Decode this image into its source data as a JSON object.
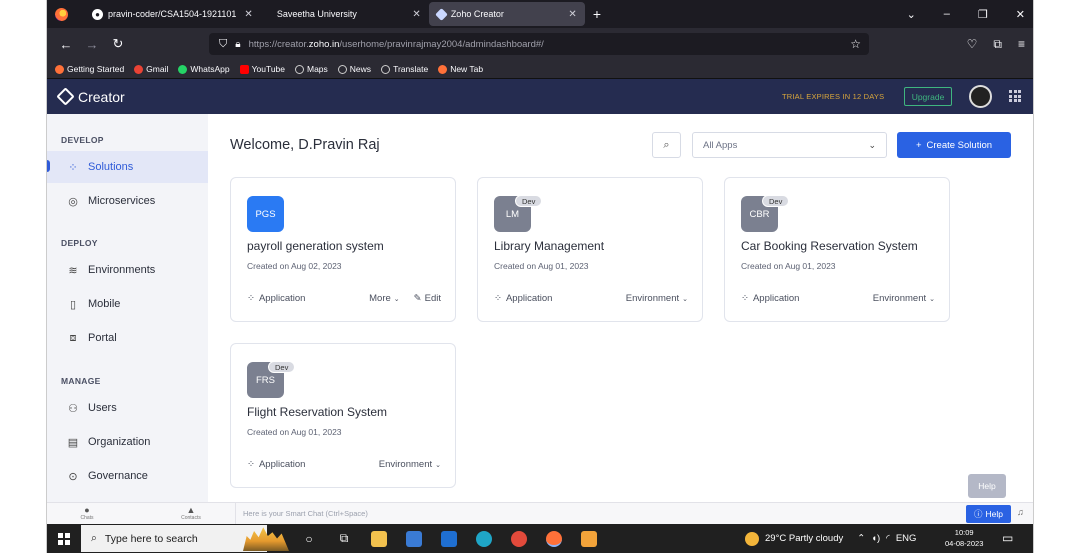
{
  "browser": {
    "tabs": [
      {
        "label": "pravin-coder/CSA1504-1921101",
        "icon": "github-icon"
      },
      {
        "label": "Saveetha University",
        "icon": "page-icon"
      },
      {
        "label": "Zoho Creator",
        "icon": "zoho-icon",
        "active": true
      }
    ],
    "url_prefix": "https://creator.",
    "url_domain": "zoho.in",
    "url_path": "/userhome/pravinrajmay2004/admindashboard#/",
    "bookmarks": [
      {
        "label": "Getting Started",
        "color": "#ff7139"
      },
      {
        "label": "Gmail",
        "color": "#ea4335"
      },
      {
        "label": "WhatsApp",
        "color": "#25d366"
      },
      {
        "label": "YouTube",
        "color": "#ff0000"
      },
      {
        "label": "Maps",
        "color": "#cccccc"
      },
      {
        "label": "News",
        "color": "#cccccc"
      },
      {
        "label": "Translate",
        "color": "#cccccc"
      },
      {
        "label": "New Tab",
        "color": "#ff7139"
      }
    ]
  },
  "app": {
    "name": "Creator",
    "trial_text": "TRIAL EXPIRES IN 12 DAYS",
    "upgrade_label": "Upgrade"
  },
  "sidebar": {
    "sections": [
      {
        "title": "DEVELOP",
        "items": [
          {
            "label": "Solutions",
            "icon": "grid-icon",
            "active": true
          },
          {
            "label": "Microservices",
            "icon": "microservices-icon"
          }
        ]
      },
      {
        "title": "DEPLOY",
        "items": [
          {
            "label": "Environments",
            "icon": "layers-icon"
          },
          {
            "label": "Mobile",
            "icon": "mobile-icon"
          },
          {
            "label": "Portal",
            "icon": "portal-icon"
          }
        ]
      },
      {
        "title": "MANAGE",
        "items": [
          {
            "label": "Users",
            "icon": "users-icon"
          },
          {
            "label": "Organization",
            "icon": "building-icon"
          },
          {
            "label": "Governance",
            "icon": "shield-check-icon"
          }
        ]
      }
    ]
  },
  "main": {
    "welcome": "Welcome, D.Pravin Raj",
    "apps_filter": "All Apps",
    "create_label": "Create Solution",
    "cards": [
      {
        "abbr": "PGS",
        "title": "payroll generation system",
        "created": "Created on Aug 02, 2023",
        "type": "Application",
        "action1": "More",
        "action2": "Edit",
        "dev": false
      },
      {
        "abbr": "LM",
        "title": "Library Management",
        "created": "Created on Aug 01, 2023",
        "type": "Application",
        "action1": "Environment",
        "dev": true
      },
      {
        "abbr": "CBR",
        "title": "Car Booking Reservation System",
        "created": "Created on Aug 01, 2023",
        "type": "Application",
        "action1": "Environment",
        "dev": true
      },
      {
        "abbr": "FRS",
        "title": "Flight Reservation System",
        "created": "Created on Aug 01, 2023",
        "type": "Application",
        "action1": "Environment",
        "dev": true
      }
    ],
    "dev_label": "Dev",
    "help_tooltip": "Help"
  },
  "chatbar": {
    "chats_label": "Chats",
    "contacts_label": "Contacts",
    "placeholder": "Here is your Smart Chat (Ctrl+Space)",
    "help_label": "Help"
  },
  "taskbar": {
    "search_placeholder": "Type here to search",
    "weather": "29°C  Partly cloudy",
    "lang": "ENG",
    "time": "10:09",
    "date": "04-08-2023"
  }
}
